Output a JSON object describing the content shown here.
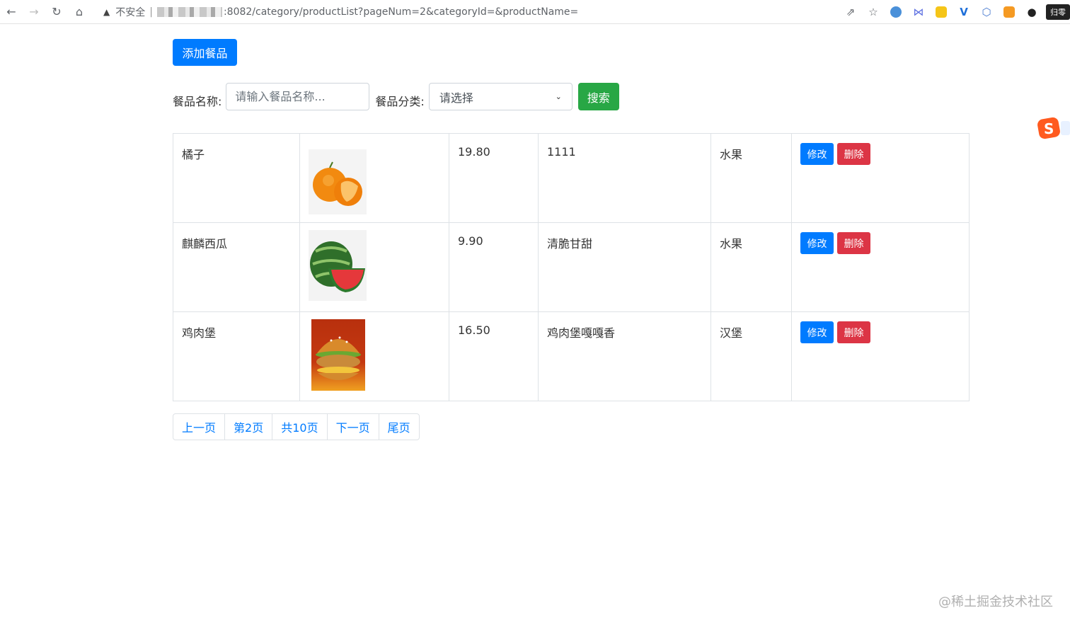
{
  "browser": {
    "insecure_label": "不安全",
    "separator": "|",
    "url_visible": ":8082/category/productList?pageNum=2&categoryId=&productName=",
    "extension_label": "归零"
  },
  "toolbar": {
    "add_label": "添加餐品"
  },
  "search": {
    "name_label": "餐品名称:",
    "name_placeholder": "请输入餐品名称...",
    "category_label": "餐品分类:",
    "category_selected": "请选择",
    "search_label": "搜索"
  },
  "products": [
    {
      "name": "橘子",
      "price": "19.80",
      "description": "1111",
      "category": "水果",
      "image": "orange"
    },
    {
      "name": "麒麟西瓜",
      "price": "9.90",
      "description": "清脆甘甜",
      "category": "水果",
      "image": "watermelon"
    },
    {
      "name": "鸡肉堡",
      "price": "16.50",
      "description": "鸡肉堡嘎嘎香",
      "category": "汉堡",
      "image": "burger"
    }
  ],
  "row_actions": {
    "edit_label": "修改",
    "delete_label": "删除"
  },
  "pagination": {
    "prev": "上一页",
    "current": "第2页",
    "total": "共10页",
    "next": "下一页",
    "last": "尾页"
  },
  "watermark": "@稀土掘金技术社区",
  "colors": {
    "primary": "#007bff",
    "success": "#28a745",
    "danger": "#dc3545"
  }
}
